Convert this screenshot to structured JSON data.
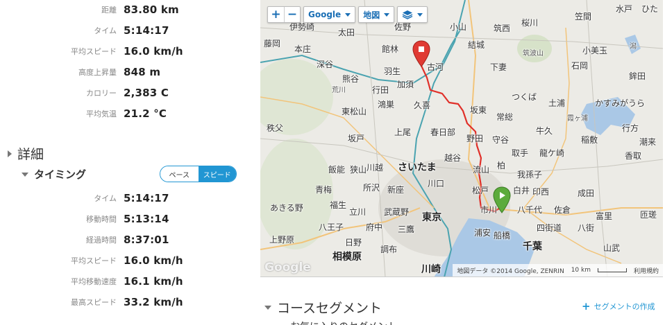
{
  "summary": [
    {
      "label": "距離",
      "value": "83.80 km"
    },
    {
      "label": "タイム",
      "value": "5:14:17"
    },
    {
      "label": "平均スピード",
      "value": "16.0 km/h"
    },
    {
      "label": "高度上昇量",
      "value": "848 m"
    },
    {
      "label": "カロリー",
      "value": "2,383 C"
    },
    {
      "label": "平均気温",
      "value": "21.2 °C"
    }
  ],
  "details": {
    "title": "詳細",
    "timing": {
      "title": "タイミング",
      "toggle": {
        "pace": "ペース",
        "speed": "スピード",
        "selected": "speed"
      },
      "rows": [
        {
          "label": "タイム",
          "value": "5:14:17"
        },
        {
          "label": "移動時間",
          "value": "5:13:14"
        },
        {
          "label": "経過時間",
          "value": "8:37:01"
        },
        {
          "label": "平均スピード",
          "value": "16.0 km/h"
        },
        {
          "label": "平均移動速度",
          "value": "16.1 km/h"
        },
        {
          "label": "最高スピード",
          "value": "33.2 km/h"
        }
      ]
    }
  },
  "map": {
    "provider_button": "Google",
    "type_button": "地図",
    "layers_icon": "layers-icon",
    "zoom_in": "+",
    "zoom_out": "−",
    "logo": "Google",
    "attribution": "地図データ ©2014 Google, ZENRIN",
    "scale": "10 km",
    "terms": "利用規約",
    "places": [
      "伊勢崎",
      "太田",
      "佐野",
      "小山",
      "筑西",
      "桜川",
      "笠間",
      "水戸",
      "ひた",
      "藤岡",
      "本庄",
      "館林",
      "結城",
      "筑波山",
      "小美玉",
      "潟",
      "深谷",
      "古河",
      "下妻",
      "石岡",
      "鉾田",
      "熊谷",
      "羽生",
      "加須",
      "つくば",
      "土浦",
      "かすみがうら",
      "荒川",
      "行田",
      "鴻巣",
      "久喜",
      "坂東",
      "霞ヶ浦",
      "東松山",
      "常総",
      "牛久",
      "秩父",
      "坂戸",
      "上尾",
      "春日部",
      "野田",
      "守谷",
      "稲敷",
      "行方",
      "潮来",
      "川越",
      "取手",
      "龍ケ崎",
      "香取",
      "越谷",
      "柏",
      "我孫子",
      "飯能",
      "狭山",
      "さいたま",
      "流山",
      "印西",
      "成田",
      "川口",
      "白井",
      "青梅",
      "所沢",
      "新座",
      "松戸",
      "八千代",
      "佐倉",
      "あきる野",
      "福生",
      "立川",
      "市川",
      "富里",
      "匝瑳",
      "武蔵野",
      "東京",
      "八街",
      "八王子",
      "府中",
      "三鷹",
      "浦安",
      "船橋",
      "四街道",
      "上野原",
      "日野",
      "千葉",
      "山武",
      "相模原",
      "調布",
      "川崎"
    ],
    "start_marker": "start-marker-icon",
    "end_marker": "end-marker-icon",
    "route_color": "#e0302a"
  },
  "course_segments": {
    "title": "コースセグメント",
    "create_link": "セグメントの作成",
    "favorites": "お気に入りのセグメント"
  }
}
